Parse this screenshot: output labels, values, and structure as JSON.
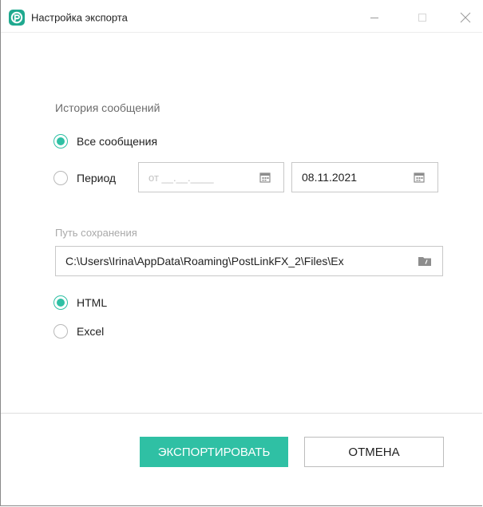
{
  "window": {
    "title": "Настройка экспорта",
    "accent_color": "#2fc0a4",
    "logo_icon": "postlink-logo-icon"
  },
  "history": {
    "label": "История сообщений",
    "options": {
      "all": {
        "label": "Все сообщения",
        "checked": true
      },
      "period": {
        "label": "Период",
        "checked": false
      }
    },
    "date_from": {
      "placeholder": "от __.__.____",
      "icon": "calendar-icon"
    },
    "date_to": {
      "value": "08.11.2021",
      "icon": "calendar-icon"
    }
  },
  "save_path": {
    "label": "Путь сохранения",
    "value": "C:\\Users\\Irina\\AppData\\Roaming\\PostLinkFX_2\\Files\\Ex",
    "icon": "folder-icon"
  },
  "format": {
    "options": {
      "html": {
        "label": "HTML",
        "checked": true
      },
      "excel": {
        "label": "Excel",
        "checked": false
      }
    }
  },
  "buttons": {
    "export": "ЭКСПОРТИРОВАТЬ",
    "cancel": "ОТМЕНА"
  }
}
